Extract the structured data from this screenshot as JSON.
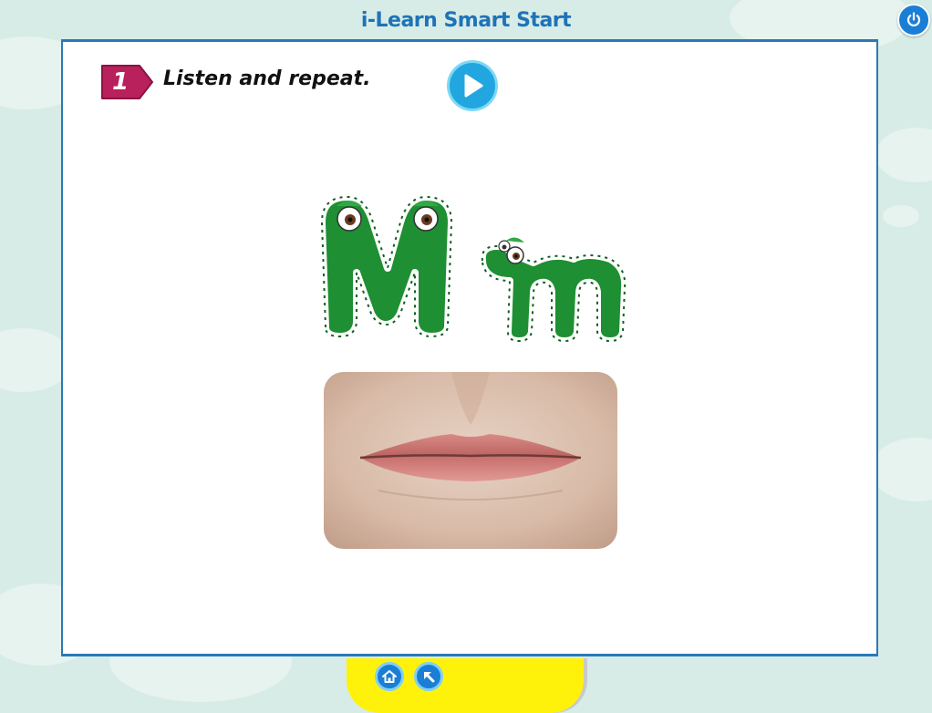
{
  "app": {
    "title": "i-Learn Smart Start"
  },
  "activity": {
    "number": "1",
    "instruction": "Listen and repeat."
  },
  "icons": {
    "power": "power-icon",
    "play": "play-icon",
    "home": "home-icon",
    "back": "back-arrow-icon"
  },
  "colors": {
    "background": "#d7ece6",
    "title": "#1e73b8",
    "badge": "#b8215b",
    "play": "#22a6e0",
    "footer": "#fff20a",
    "monster_green": "#1e8f32"
  }
}
